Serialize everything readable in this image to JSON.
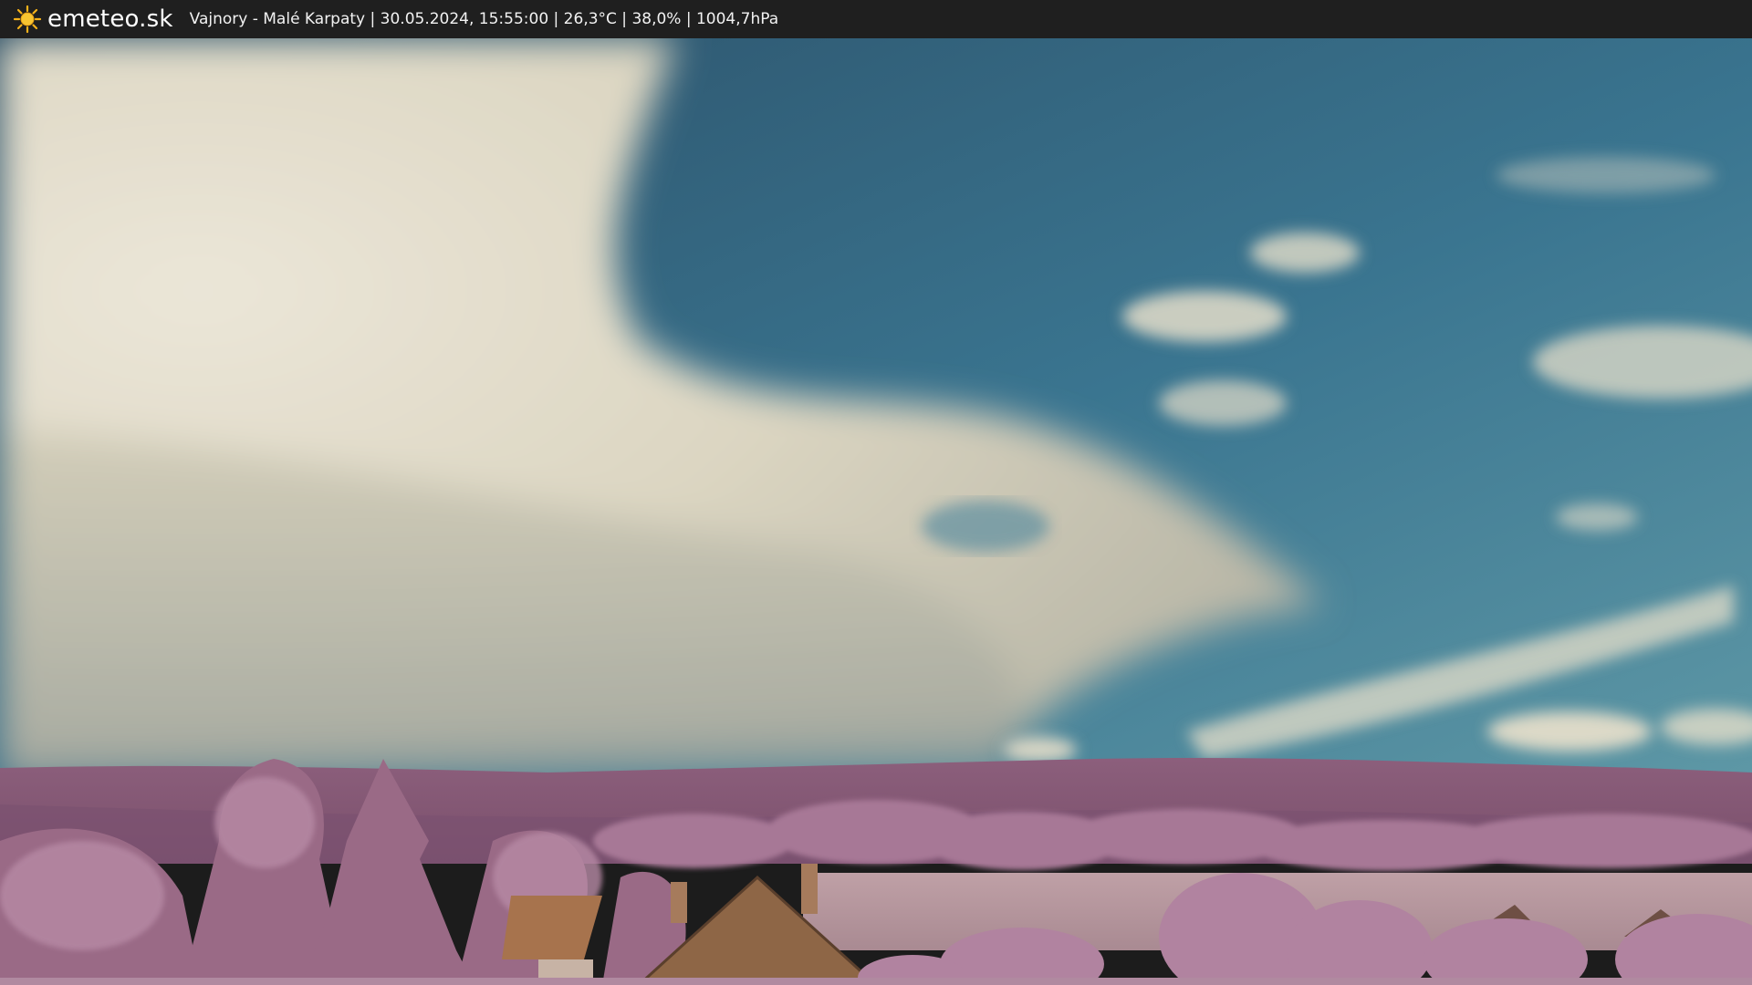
{
  "header": {
    "brand": "emeteo.sk",
    "caption": "Vajnory - Malé Karpaty | 30.05.2024, 15:55:00 | 26,3°C | 38,0% | 1004,7hPa",
    "logo_icon": "sun-icon",
    "bar_color": "#1f1f1f",
    "sun_color": "#f6b21a"
  },
  "scene": {
    "sky_colors": [
      "#2f5d78",
      "#3f7d97",
      "#5f94a3"
    ],
    "cloud_color": "#e6e0cf",
    "hill_color": "#8a5a78",
    "foliage_color": "#b07d9c",
    "roof_color": "#9a6a45"
  }
}
